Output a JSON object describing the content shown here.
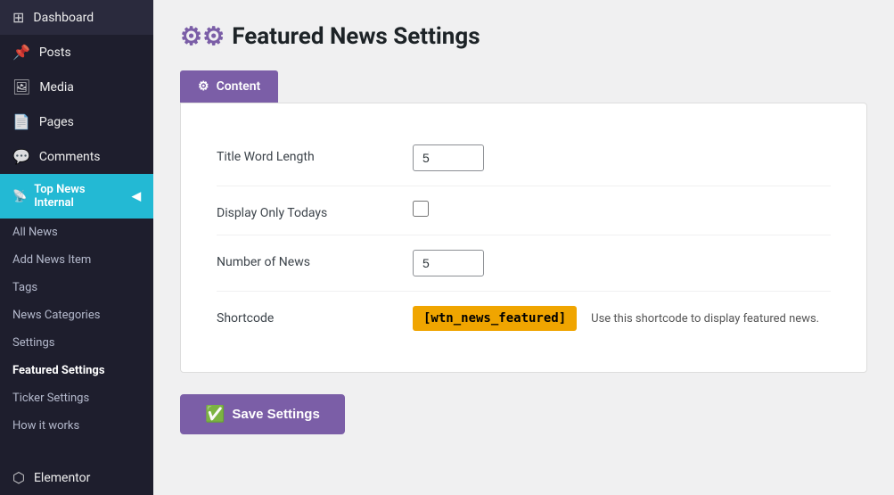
{
  "sidebar": {
    "nav_items": [
      {
        "id": "dashboard",
        "label": "Dashboard",
        "icon": "⊞"
      },
      {
        "id": "posts",
        "label": "Posts",
        "icon": "📌"
      },
      {
        "id": "media",
        "label": "Media",
        "icon": "🖼"
      },
      {
        "id": "pages",
        "label": "Pages",
        "icon": "📄"
      },
      {
        "id": "comments",
        "label": "Comments",
        "icon": "💬"
      }
    ],
    "plugin_header": "Top News Internal",
    "plugin_items": [
      {
        "id": "all-news",
        "label": "All News",
        "active": false
      },
      {
        "id": "add-news-item",
        "label": "Add News Item",
        "active": false
      },
      {
        "id": "tags",
        "label": "Tags",
        "active": false
      },
      {
        "id": "news-categories",
        "label": "News Categories",
        "active": false
      },
      {
        "id": "settings",
        "label": "Settings",
        "active": false
      },
      {
        "id": "featured-settings",
        "label": "Featured Settings",
        "active": true
      },
      {
        "id": "ticker-settings",
        "label": "Ticker Settings",
        "active": false
      },
      {
        "id": "how-it-works",
        "label": "How it works",
        "active": false
      }
    ],
    "bottom_item": "Elementor"
  },
  "page": {
    "title": "Featured News Settings",
    "title_icon": "⚙",
    "tabs": [
      {
        "id": "content",
        "label": "Content",
        "icon": "⚙",
        "active": true
      }
    ],
    "form": {
      "fields": [
        {
          "id": "title-word-length",
          "label": "Title Word Length",
          "type": "number",
          "value": "5"
        },
        {
          "id": "display-only-todays",
          "label": "Display Only Todays",
          "type": "checkbox",
          "checked": false
        },
        {
          "id": "number-of-news",
          "label": "Number of News",
          "type": "number",
          "value": "5"
        },
        {
          "id": "shortcode",
          "label": "Shortcode",
          "type": "shortcode",
          "code": "[wtn_news_featured]",
          "desc": "Use this shortcode to display featured news."
        }
      ]
    },
    "save_button": "Save Settings"
  }
}
